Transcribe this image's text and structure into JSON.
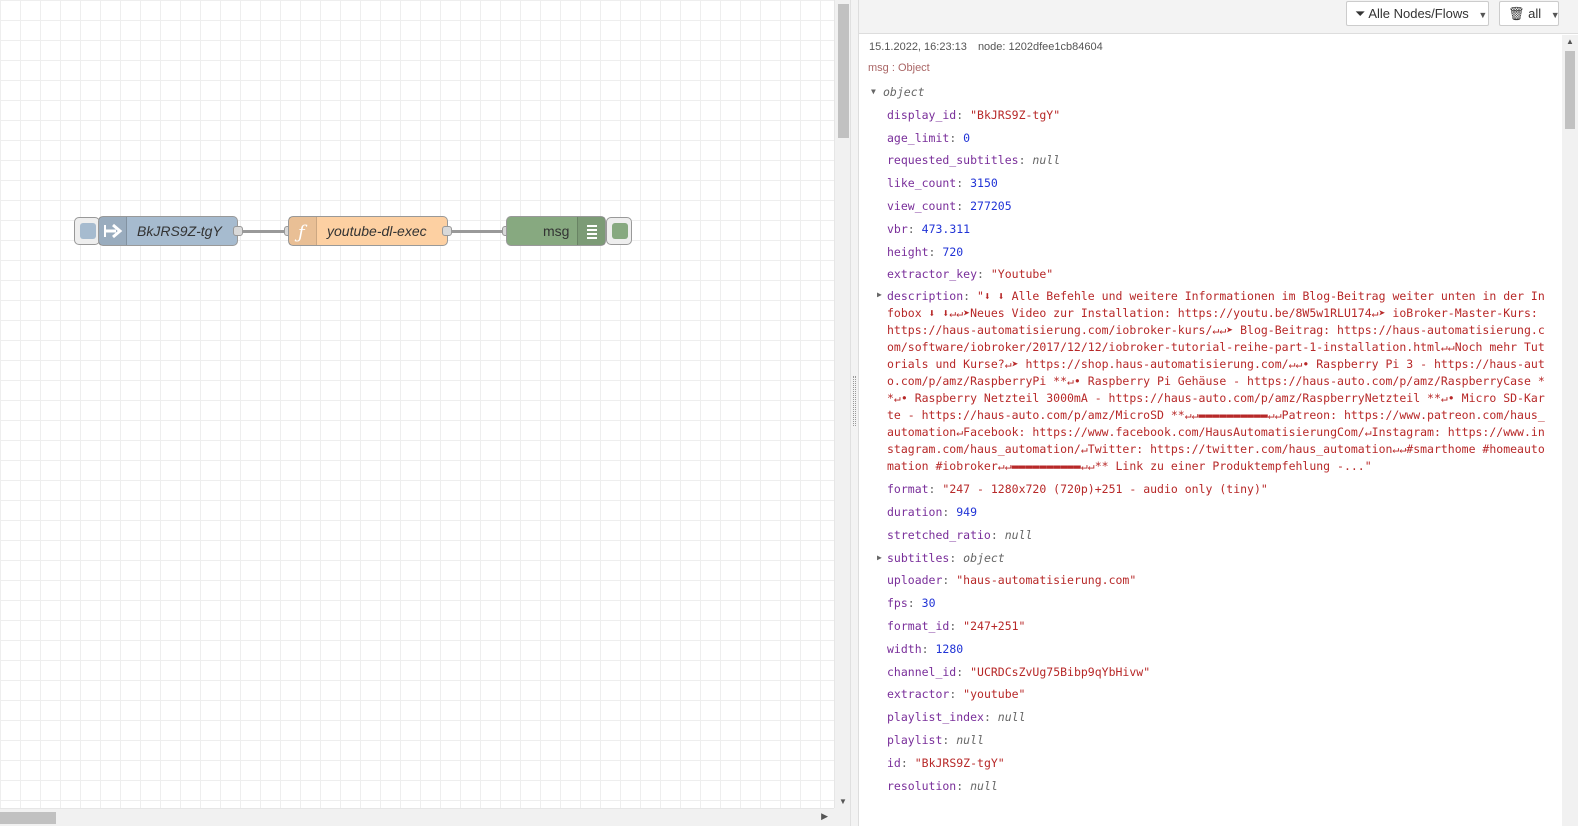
{
  "workspace": {
    "nodes": [
      {
        "id": "inject",
        "label": "BkJRS9Z-tgY",
        "color": "#a6bbcf"
      },
      {
        "id": "function",
        "label": "youtube-dl-exec",
        "color": "#fdd0a2"
      },
      {
        "id": "debug",
        "label": "msg",
        "color": "#87a980"
      }
    ]
  },
  "sidebar": {
    "filter_label": "Alle Nodes/Flows",
    "clear_label": "all"
  },
  "debug": {
    "timestamp": "15.1.2022, 16:23:13",
    "node": "node: 1202dfee1cb84604",
    "topic": "msg : Object",
    "root_label": "object",
    "rows": [
      {
        "key": "display_id",
        "value": "\"BkJRS9Z-tgY\"",
        "type": "str"
      },
      {
        "key": "age_limit",
        "value": "0",
        "type": "num"
      },
      {
        "key": "requested_subtitles",
        "value": "null",
        "type": "nul"
      },
      {
        "key": "like_count",
        "value": "3150",
        "type": "num"
      },
      {
        "key": "view_count",
        "value": "277205",
        "type": "num"
      },
      {
        "key": "vbr",
        "value": "473.311",
        "type": "num"
      },
      {
        "key": "height",
        "value": "720",
        "type": "num"
      },
      {
        "key": "extractor_key",
        "value": "\"Youtube\"",
        "type": "str"
      }
    ],
    "description_key": "description",
    "description_value": "\"⬇ ⬇ Alle Befehle und weitere Informationen im Blog-Beitrag weiter unten in der Infobox ⬇ ⬇↵↵➤Neues Video zur Installation: https://youtu.be/8W5w1RLU174↵➤ ioBroker-Master-Kurs: https://haus-automatisierung.com/iobroker-kurs/↵↵➤ Blog-Beitrag: https://haus-automatisierung.com/software/iobroker/2017/12/12/iobroker-tutorial-reihe-part-1-installation.html↵↵Noch mehr Tutorials und Kurse?↵➤ https://shop.haus-automatisierung.com/↵↵• Raspberry Pi 3 - https://haus-auto.com/p/amz/RaspberryPi **↵• Raspberry Pi Gehäuse - https://haus-auto.com/p/amz/RaspberryCase **↵• Raspberry Netzteil 3000mA - https://haus-auto.com/p/amz/RaspberryNetzteil **↵• Micro SD-Karte - https://haus-auto.com/p/amz/MicroSD **↵↵▬▬▬▬▬▬▬▬▬▬↵↵Patreon: https://www.patreon.com/haus_automation↵Facebook: https://www.facebook.com/HausAutomatisierungCom/↵Instagram: https://www.instagram.com/haus_automation/↵Twitter: https://twitter.com/haus_automation↵↵#smarthome #homeautomation #iobroker↵↵▬▬▬▬▬▬▬▬▬▬↵↵** Link zu einer Produktempfehlung -...\"",
    "rows2": [
      {
        "key": "format",
        "value": "\"247 - 1280x720 (720p)+251 - audio only (tiny)\"",
        "type": "str"
      },
      {
        "key": "duration",
        "value": "949",
        "type": "num"
      },
      {
        "key": "stretched_ratio",
        "value": "null",
        "type": "nul"
      }
    ],
    "subtitles_key": "subtitles",
    "subtitles_value": "object",
    "rows3": [
      {
        "key": "uploader",
        "value": "\"haus-automatisierung.com\"",
        "type": "str"
      },
      {
        "key": "fps",
        "value": "30",
        "type": "num"
      },
      {
        "key": "format_id",
        "value": "\"247+251\"",
        "type": "str"
      },
      {
        "key": "width",
        "value": "1280",
        "type": "num"
      },
      {
        "key": "channel_id",
        "value": "\"UCRDCsZvUg75Bibp9qYbHivw\"",
        "type": "str"
      },
      {
        "key": "extractor",
        "value": "\"youtube\"",
        "type": "str"
      },
      {
        "key": "playlist_index",
        "value": "null",
        "type": "nul"
      },
      {
        "key": "playlist",
        "value": "null",
        "type": "nul"
      },
      {
        "key": "id",
        "value": "\"BkJRS9Z-tgY\"",
        "type": "str"
      },
      {
        "key": "resolution",
        "value": "null",
        "type": "nul"
      }
    ]
  }
}
